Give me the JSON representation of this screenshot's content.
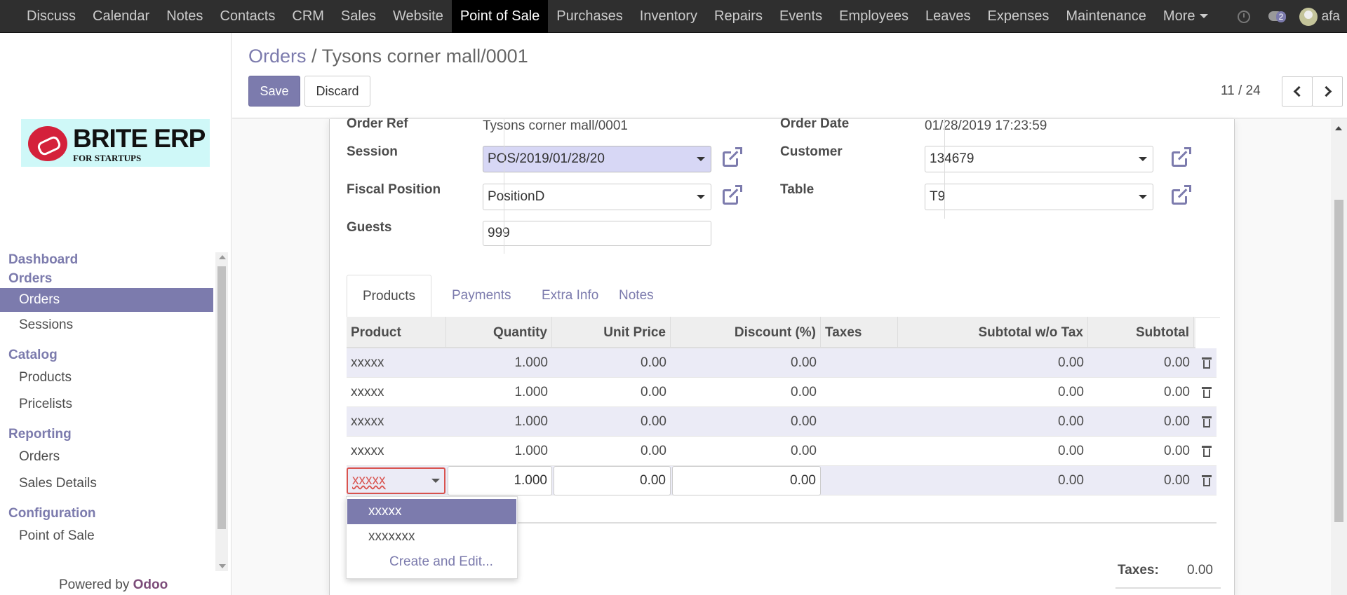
{
  "topbar": {
    "menu": [
      "Discuss",
      "Calendar",
      "Notes",
      "Contacts",
      "CRM",
      "Sales",
      "Website",
      "Point of Sale",
      "Purchases",
      "Inventory",
      "Repairs",
      "Events",
      "Employees",
      "Leaves",
      "Expenses",
      "Maintenance",
      "More"
    ],
    "active": "Point of Sale",
    "chat_badge": "2",
    "user": "afa",
    "icons": [
      "clock-icon",
      "chat-icon",
      "avatar"
    ]
  },
  "sidebar": {
    "logo_text": "BRITE ERP",
    "logo_tagline": "FOR STARTUPS",
    "sections": [
      {
        "heading": "Dashboard",
        "items": []
      },
      {
        "heading": "Orders",
        "items": [
          "Orders",
          "Sessions"
        ]
      },
      {
        "heading": "Catalog",
        "items": [
          "Products",
          "Pricelists"
        ]
      },
      {
        "heading": "Reporting",
        "items": [
          "Orders",
          "Sales Details"
        ]
      },
      {
        "heading": "Configuration",
        "items": [
          "Point of Sale"
        ]
      }
    ],
    "active_item": "Orders",
    "powered_prefix": "Powered by",
    "powered_brand": "Odoo"
  },
  "control_panel": {
    "breadcrumb_root": "Orders",
    "breadcrumb_sep": "/",
    "breadcrumb_current": "Tysons corner mall/0001",
    "save_label": "Save",
    "discard_label": "Discard",
    "pager": "11 / 24"
  },
  "form": {
    "order_ref_label": "Order Ref",
    "order_ref_value": "Tysons corner mall/0001",
    "session_label": "Session",
    "session_value": "POS/2019/01/28/20",
    "fiscal_label": "Fiscal Position",
    "fiscal_value": "PositionD",
    "guests_label": "Guests",
    "guests_value": "999",
    "order_date_label": "Order Date",
    "order_date_value": "01/28/2019 17:23:59",
    "customer_label": "Customer",
    "customer_value": "134679",
    "table_label": "Table",
    "table_value": "T9"
  },
  "tabs": [
    "Products",
    "Payments",
    "Extra Info",
    "Notes"
  ],
  "lines": {
    "headers": [
      "Product",
      "Quantity",
      "Unit Price",
      "Discount (%)",
      "Taxes",
      "Subtotal w/o Tax",
      "Subtotal"
    ],
    "rows": [
      [
        "xxxxx",
        "1.000",
        "0.00",
        "0.00",
        "",
        "0.00",
        "0.00"
      ],
      [
        "xxxxx",
        "1.000",
        "0.00",
        "0.00",
        "",
        "0.00",
        "0.00"
      ],
      [
        "xxxxx",
        "1.000",
        "0.00",
        "0.00",
        "",
        "0.00",
        "0.00"
      ],
      [
        "xxxxx",
        "1.000",
        "0.00",
        "0.00",
        "",
        "0.00",
        "0.00"
      ]
    ],
    "edit_row": [
      "xxxxx",
      "1.000",
      "0.00",
      "0.00",
      "",
      "0.00",
      "0.00"
    ]
  },
  "dropdown": {
    "options": [
      "xxxxx",
      "xxxxxxx"
    ],
    "create_label": "Create and Edit..."
  },
  "totals": {
    "taxes_label": "Taxes:",
    "taxes_value": "0.00"
  }
}
